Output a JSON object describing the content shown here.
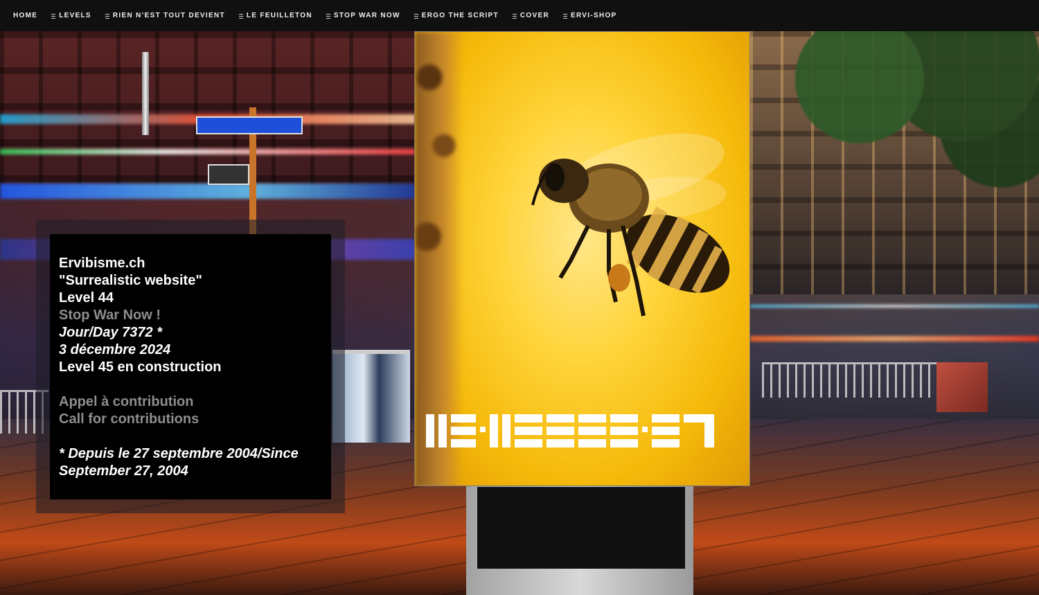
{
  "nav": {
    "items": [
      {
        "label": "HOME",
        "has_icon": false
      },
      {
        "label": "LEVELS",
        "has_icon": true
      },
      {
        "label": "RIEN N’EST TOUT DEVIENT",
        "has_icon": true
      },
      {
        "label": "LE FEUILLETON",
        "has_icon": true
      },
      {
        "label": "STOP WAR NOW",
        "has_icon": true
      },
      {
        "label": "ERGO THE SCRIPT",
        "has_icon": true
      },
      {
        "label": "COVER",
        "has_icon": true
      },
      {
        "label": "ERVI-SHOP",
        "has_icon": true
      }
    ],
    "icon": "menu-icon"
  },
  "panel": {
    "site": "Ervibisme.ch",
    "tagline": "\"Surrealistic website\"",
    "level": "Level 44",
    "stop_war": "Stop War Now !",
    "day": "Jour/Day 7372 *",
    "date": "3 décembre 2024",
    "next_level": "Level 45 en construction",
    "contrib_fr": "Appel à contribution",
    "contrib_en": "Call for contributions",
    "since_1": "* Depuis le 27 septembre 2004/Since",
    "since_2": "September 27, 2004"
  },
  "poster": {
    "image": "bee-on-yellow",
    "mark": "stylized-glyph-logo"
  },
  "colors": {
    "nav_bg": "#101010",
    "panel_bg": "#000000",
    "muted_text": "#8e8e8e",
    "poster_yellow": "#ffd43a"
  }
}
